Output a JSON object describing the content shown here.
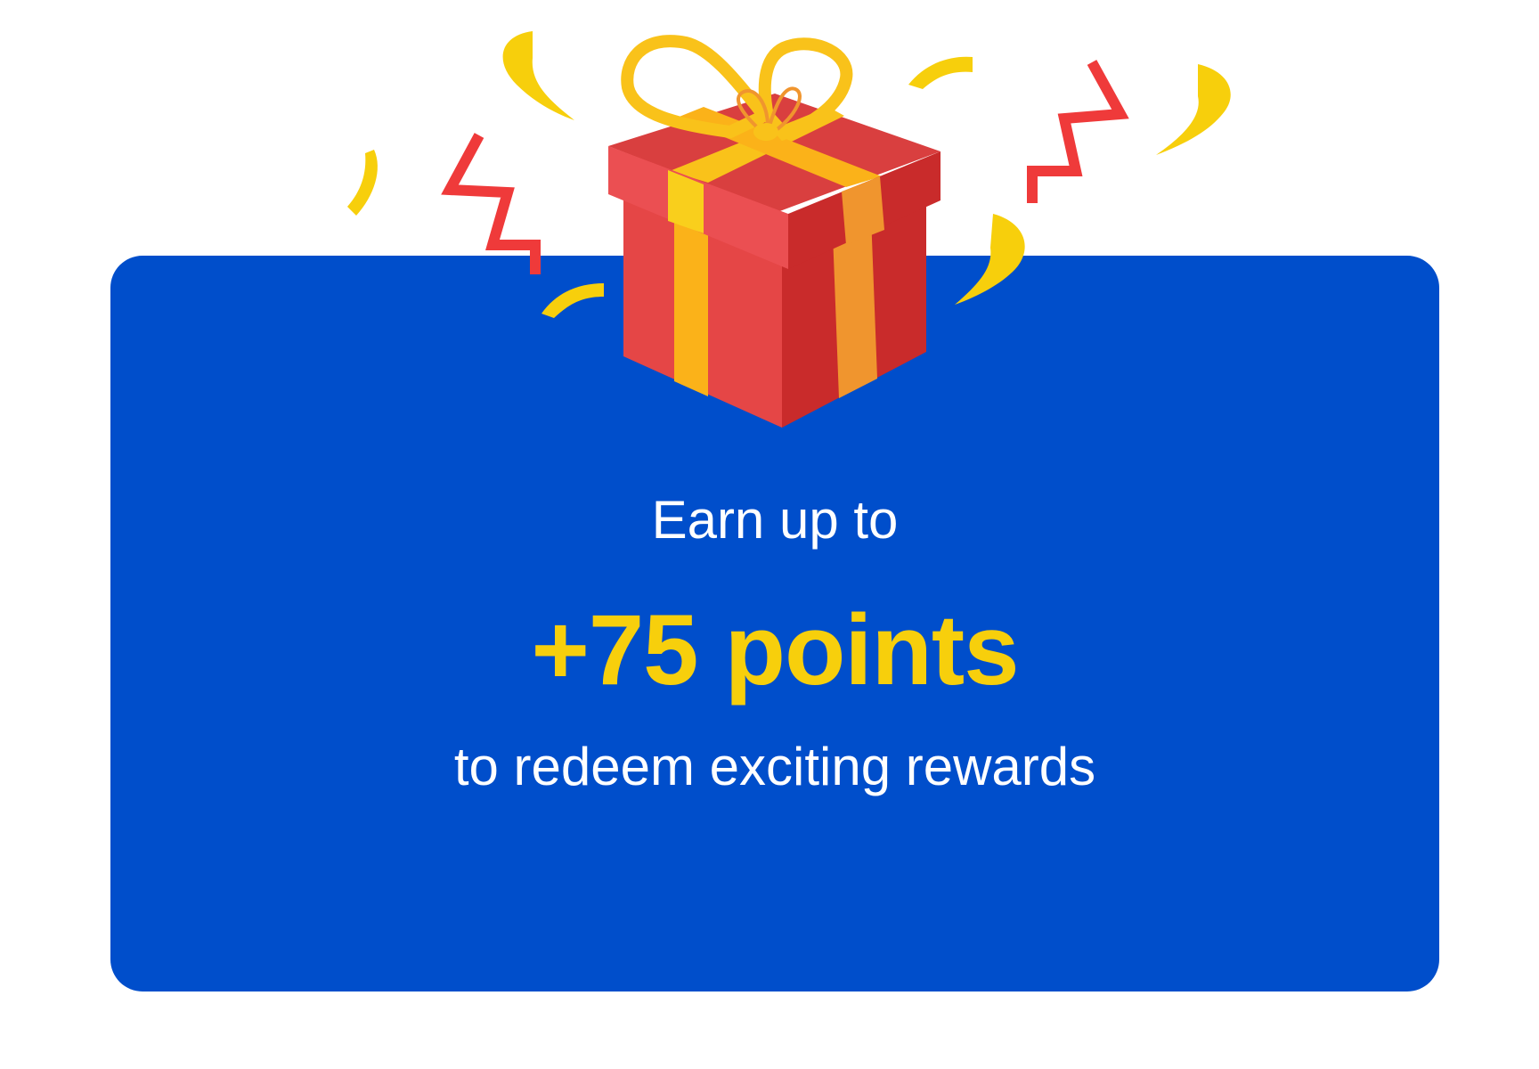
{
  "promo": {
    "headline": "Earn up to",
    "points": "+75 points",
    "subline": "to redeem exciting rewards"
  },
  "icons": {
    "gift": "gift-box-icon",
    "confetti": "confetti-icon"
  },
  "colors": {
    "card_background": "#004ecb",
    "points_text": "#f7cf0c",
    "body_text": "#ffffff",
    "gift_red": "#e54646",
    "ribbon_yellow": "#f9c21a",
    "confetti_red": "#ef3a3a",
    "confetti_yellow": "#f7cf0c"
  }
}
